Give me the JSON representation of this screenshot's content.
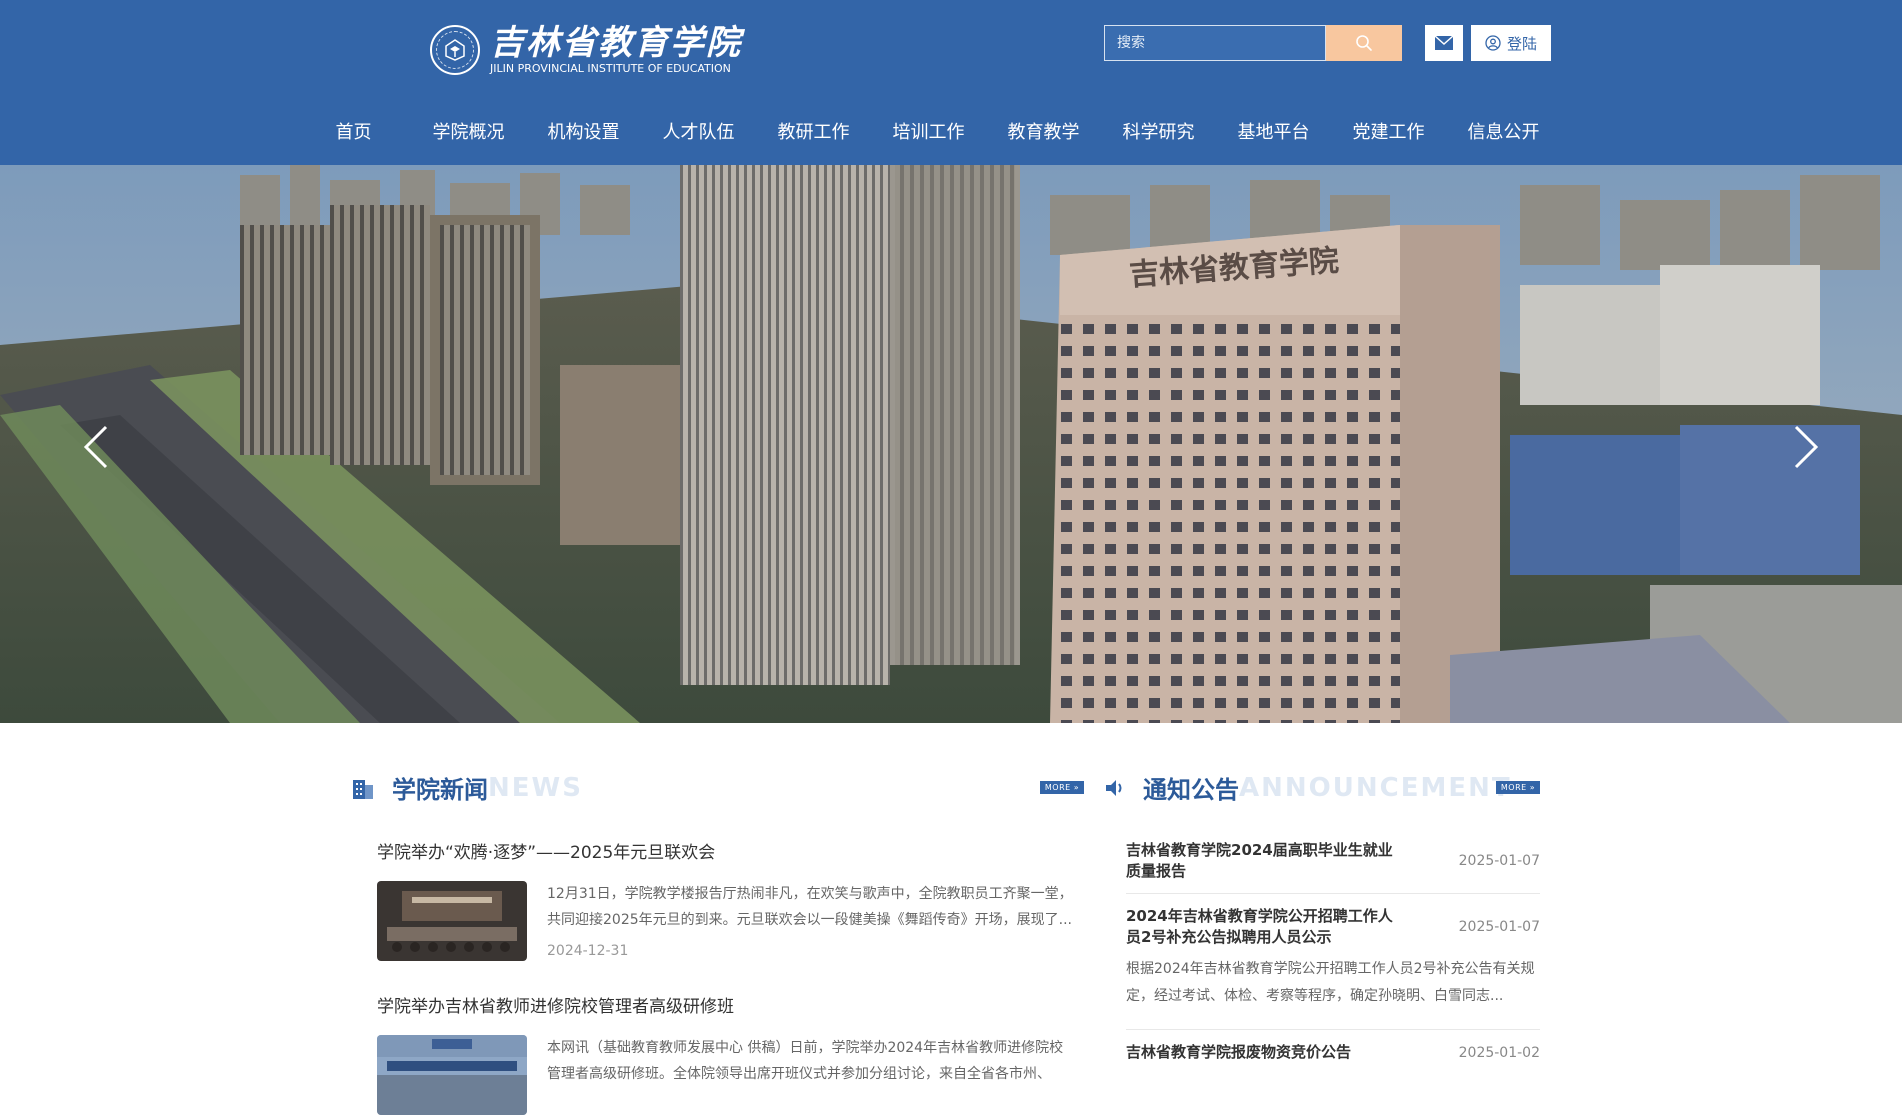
{
  "header": {
    "logo": {
      "name_cn": "吉林省教育学院",
      "name_en": "JILIN PROVINCIAL INSTITUTE OF EDUCATION",
      "seal_text": "吉林省教育学院"
    },
    "search": {
      "placeholder": "搜索",
      "icon": "search-icon"
    },
    "mail_icon": "mail-icon",
    "login_label": "登陆",
    "login_icon": "user-icon",
    "colors": {
      "primary": "#3365a8",
      "search_button": "#f8c79f"
    }
  },
  "nav": {
    "items": [
      "首页",
      "学院概况",
      "机构设置",
      "人才队伍",
      "教研工作",
      "培训工作",
      "教育教学",
      "科学研究",
      "基地平台",
      "党建工作",
      "信息公开"
    ]
  },
  "banner": {
    "building_sign": "吉林省教育学院",
    "prev_icon": "chevron-left-icon",
    "next_icon": "chevron-right-icon"
  },
  "news": {
    "title_cn": "学院新闻",
    "title_en": "NEWS",
    "more_label": "MORE »",
    "items": [
      {
        "title": "学院举办“欢腾·逐梦”——2025年元旦联欢会",
        "summary": "12月31日，学院教学楼报告厅热闹非凡，在欢笑与歌声中，全院教职员工齐聚一堂，共同迎接2025年元旦的到来。元旦联欢会以一段健美操《舞蹈传奇》开场，展现了...",
        "date": "2024-12-31"
      },
      {
        "title": "学院举办吉林省教师进修院校管理者高级研修班",
        "summary": "本网讯（基础教育教师发展中心 供稿）日前，学院举办2024年吉林省教师进修院校管理者高级研修班。全体院领导出席开班仪式并参加分组讨论，来自全省各市州、县...",
        "date": ""
      }
    ]
  },
  "notices": {
    "title_cn": "通知公告",
    "title_en": "ANNOUNCEMENT",
    "more_label": "MORE »",
    "items": [
      {
        "title": "吉林省教育学院2024届高职毕业生就业质量报告",
        "date": "2025-01-07",
        "summary": ""
      },
      {
        "title": "2024年吉林省教育学院公开招聘工作人员2号补充公告拟聘用人员公示",
        "date": "2025-01-07",
        "summary": "根据2024年吉林省教育学院公开招聘工作人员2号补充公告有关规定，经过考试、体检、考察等程序，确定孙晓明、白雪同志..."
      },
      {
        "title": "吉林省教育学院报废物资竞价公告",
        "date": "2025-01-02",
        "summary": ""
      }
    ]
  }
}
